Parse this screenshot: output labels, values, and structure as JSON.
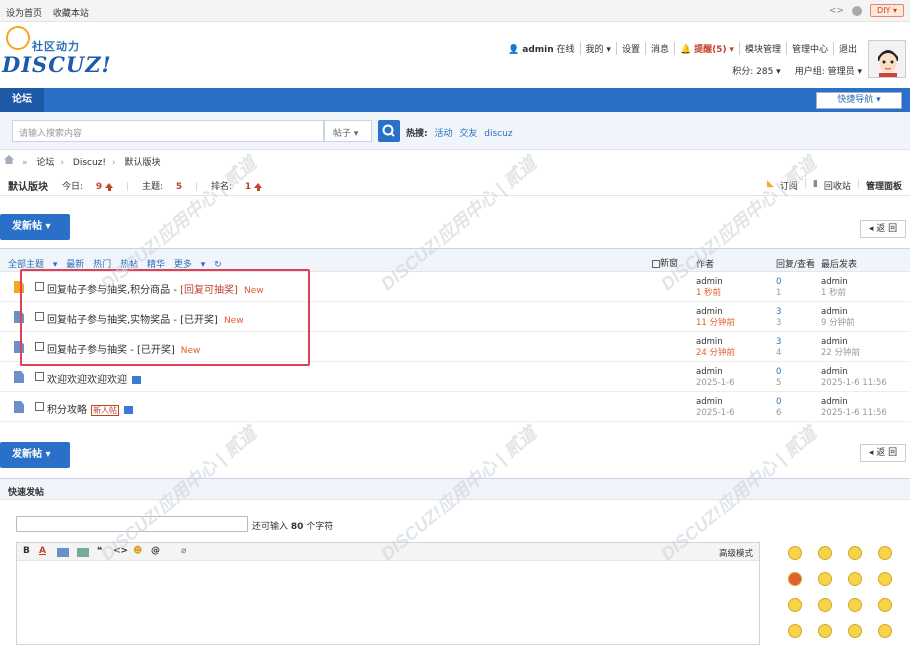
{
  "topbar": {
    "set_home": "设为首页",
    "bookmark": "收藏本站",
    "diy": "DIY"
  },
  "header": {
    "logo_cn": "社区动力",
    "logo_en": "DISCUZ!",
    "user": "admin",
    "online": "在线",
    "mine": "我的",
    "settings": "设置",
    "messages": "消息",
    "remind": "提醒(5)",
    "block_mgmt": "模块管理",
    "admin_center": "管理中心",
    "logout": "退出",
    "credits": "积分: 285",
    "usergroup": "用户组: 管理员"
  },
  "nav": {
    "tab": "论坛",
    "quick_nav": "快捷导航"
  },
  "search": {
    "placeholder": "请输入搜索内容",
    "type": "帖子",
    "hot_label": "热搜:",
    "hot": [
      "活动",
      "交友",
      "discuz"
    ]
  },
  "breadcrumb": [
    "论坛",
    "Discuz!",
    "默认版块"
  ],
  "forum": {
    "name": "默认版块",
    "today_label": "今日:",
    "today": "9",
    "threads_label": "主题:",
    "threads": "5",
    "rank_label": "排名:",
    "rank": "1",
    "subscribe": "订阅",
    "recycle": "回收站",
    "manage": "管理面板"
  },
  "buttons": {
    "post": "发新帖",
    "back": "返 回"
  },
  "list_header": {
    "filters": [
      "全部主题",
      "最新",
      "热门",
      "热帖",
      "精华",
      "更多"
    ],
    "new_window": "新窗",
    "author": "作者",
    "replies": "回复/查看",
    "last": "最后发表"
  },
  "threads": [
    {
      "title": "回复帖子参与抽奖,积分商品 - ",
      "tag": "[回复可抽奖]",
      "new": "New",
      "author": "admin",
      "date": "1 秒前",
      "date_red": true,
      "replies": "0",
      "views": "1",
      "last_author": "admin",
      "last_date": "1 秒前",
      "hot": true
    },
    {
      "title": "回复帖子参与抽奖,实物奖品 - [已开奖]",
      "tag": "",
      "new": "New",
      "author": "admin",
      "date": "11 分钟前",
      "date_red": true,
      "replies": "3",
      "views": "3",
      "last_author": "admin",
      "last_date": "9 分钟前"
    },
    {
      "title": "回复帖子参与抽奖 - [已开奖]",
      "tag": "",
      "new": "New",
      "author": "admin",
      "date": "24 分钟前",
      "date_red": true,
      "replies": "3",
      "views": "4",
      "last_author": "admin",
      "last_date": "22 分钟前"
    },
    {
      "title": "欢迎欢迎欢迎欢迎",
      "tag": "",
      "new": "",
      "author": "admin",
      "date": "2025-1-6",
      "date_red": false,
      "replies": "0",
      "views": "5",
      "last_author": "admin",
      "last_date": "2025-1-6 11:56",
      "pic": true
    },
    {
      "title": "积分攻略",
      "tag": "",
      "new": "",
      "newbie": "新人帖",
      "author": "admin",
      "date": "2025-1-6",
      "date_red": false,
      "replies": "0",
      "views": "6",
      "last_author": "admin",
      "last_date": "2025-1-6 11:56",
      "pic": true
    }
  ],
  "quickpost": {
    "title": "快速发帖",
    "count_pre": "还可输入",
    "count": "80",
    "count_post": "个字符",
    "advanced": "高级模式"
  },
  "watermark": "DISCUZ!应用中心 | 贰道"
}
